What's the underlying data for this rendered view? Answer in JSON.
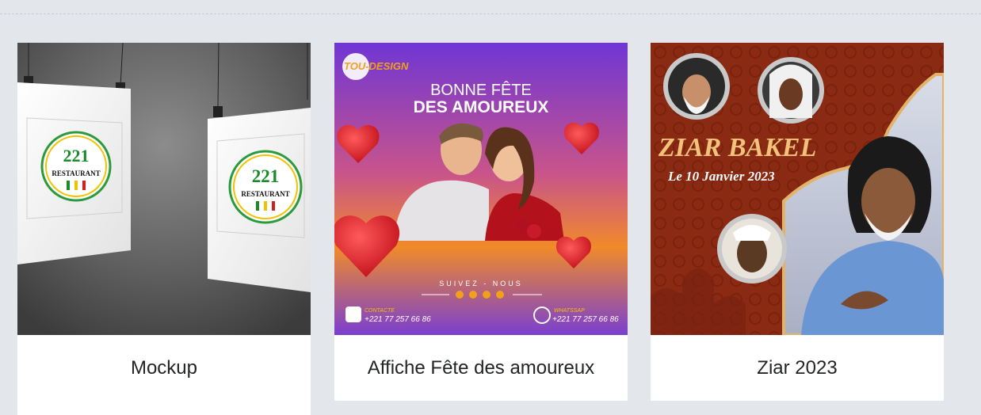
{
  "portfolio": {
    "items": [
      {
        "title": "Mockup",
        "logo": {
          "number": "221",
          "word": "RESTAURANT"
        },
        "image_description": "Two hanging paper posters on a concrete wall"
      },
      {
        "title": "Affiche Fête des amoureux",
        "brand": "TOU-DESIGN",
        "headline_line1": "BONNE FÊTE",
        "headline_line2": "DES AMOUREUX",
        "follow": "SUIVEZ  -  NOUS",
        "contact_label": "CONTACTE",
        "contact_number": "+221 77 257 66 86",
        "whatsapp_label": "WHATSSAP",
        "whatsapp_number": "+221 77 257 66 86"
      },
      {
        "title": "Ziar 2023",
        "headline": "ZIAR BAKEL",
        "date": "Le 10 Janvier 2023"
      }
    ]
  },
  "colors": {
    "page_bg": "#e3e6ea",
    "card_bg": "#ffffff",
    "title_text": "#222426",
    "poster_purple": "#7a3fd0",
    "poster_orange": "#f08a2a",
    "ziar_brown": "#8a2a12",
    "ziar_gold": "#f1c27a"
  }
}
